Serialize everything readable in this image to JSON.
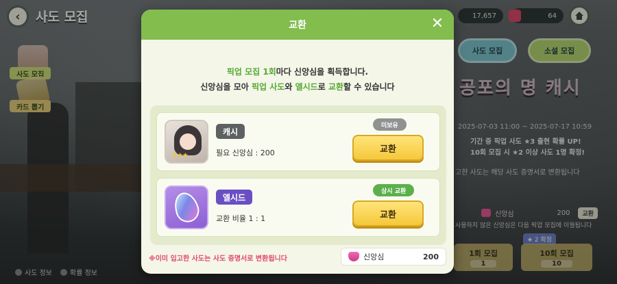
{
  "topbar": {
    "page_title": "사도 모집",
    "resource_1": "17,657",
    "resource_2": "64"
  },
  "sidebar": {
    "items": [
      {
        "label": "사도 모집"
      },
      {
        "label": "카드 뽑기"
      }
    ]
  },
  "right_panel": {
    "tabs": [
      {
        "label": "사도 모집"
      },
      {
        "label": "소설 모집"
      }
    ],
    "banner_title": "공포의 명 캐시",
    "period": "2025-07-03 11:00 ~ 2025-07-17 10:59",
    "line_1": "기간 중 픽업 사도 ★3 출현 확률 UP!",
    "line_2": "10회 모집 시 ★2 이상 사도 1명 확정!",
    "line_3": "고한 사도는 해당 사도 증명서로 변환됩니다",
    "heart_label": "신앙심",
    "heart_value": "200",
    "heart_exchange": "교환",
    "heart_note": "사용하지 않은 신앙심은 다음 픽업 모집에 이월됩니다",
    "guarantee_tag": "★ 2 확정",
    "draw_1_label": "1회 모집",
    "draw_1_cost": "1",
    "draw_10_label": "10회 모집",
    "draw_10_cost": "10"
  },
  "footer": {
    "link_1": "사도 정보",
    "link_2": "확률 정보"
  },
  "modal": {
    "title": "교환",
    "desc_1_hl": "픽업 모집 1회",
    "desc_1_rest": "마다 신앙심을 획득합니다.",
    "desc_2_a": "신앙심을 모아 ",
    "desc_2_hl1": "픽업 사도",
    "desc_2_b": "와 ",
    "desc_2_hl2": "엘시드",
    "desc_2_c": "로 ",
    "desc_2_hl3": "교환",
    "desc_2_d": "할 수 있습니다",
    "items": [
      {
        "name": "캐시",
        "info": "필요 신앙심 : 200",
        "status": "미보유",
        "button": "교환"
      },
      {
        "name": "엘시드",
        "info": "교환 비율 1 : 1",
        "status": "상시 교환",
        "button": "교환"
      }
    ],
    "notice": "※이미 입고한 사도는 사도 증명서로 변환됩니다",
    "currency_label": "신앙심",
    "currency_amount": "200"
  },
  "colors": {
    "header_green": "#82bd4e",
    "highlight_green": "#58a936",
    "exchange_yellow": "#f5c83b",
    "notice_pink": "#e24a6c"
  }
}
